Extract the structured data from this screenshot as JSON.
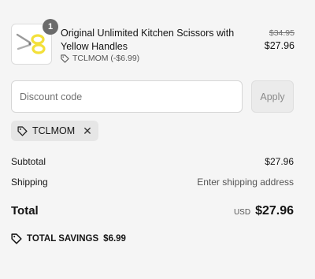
{
  "product": {
    "quantity": "1",
    "title": "Original Unlimited Kitchen Scissors with Yellow Handles",
    "discount_label": "TCLMOM (-$6.99)",
    "original_price": "$34.95",
    "price": "$27.96"
  },
  "discount": {
    "placeholder": "Discount code",
    "value": "",
    "apply_label": "Apply",
    "applied_code": "TCLMOM"
  },
  "summary": {
    "subtotal_label": "Subtotal",
    "subtotal_value": "$27.96",
    "shipping_label": "Shipping",
    "shipping_value": "Enter shipping address",
    "total_label": "Total",
    "currency": "USD",
    "total_value": "$27.96",
    "savings_label": "TOTAL SAVINGS",
    "savings_value": "$6.99"
  },
  "colors": {
    "background": "#f5f5f5",
    "scissor_handles": "#f3e03a"
  },
  "icons": {
    "tag": "tag-icon",
    "close": "close-icon",
    "product": "scissors-icon"
  }
}
